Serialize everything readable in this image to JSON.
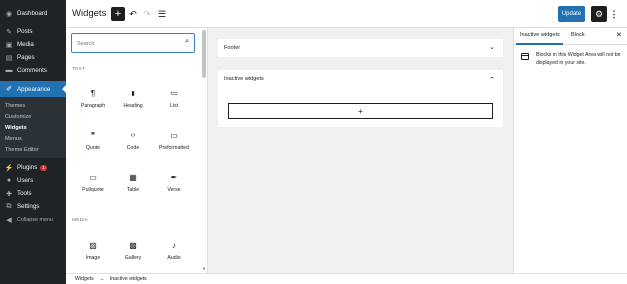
{
  "admin_menu": {
    "items": [
      {
        "label": "Dashboard",
        "icon": "dashboard-icon",
        "glyph": "◉"
      },
      {
        "label": "Posts",
        "icon": "pin-icon",
        "glyph": "✎"
      },
      {
        "label": "Media",
        "icon": "media-icon",
        "glyph": "▣"
      },
      {
        "label": "Pages",
        "icon": "page-icon",
        "glyph": "▤"
      },
      {
        "label": "Comments",
        "icon": "comment-icon",
        "glyph": "▬"
      },
      {
        "label": "Appearance",
        "icon": "brush-icon",
        "glyph": "✐"
      }
    ],
    "submenu": [
      "Themes",
      "Customize",
      "Widgets",
      "Menus",
      "Theme Editor"
    ],
    "items_after": [
      {
        "label": "Plugins",
        "icon": "plug-icon",
        "glyph": "⚡",
        "badge": "1"
      },
      {
        "label": "Users",
        "icon": "users-icon",
        "glyph": "●"
      },
      {
        "label": "Tools",
        "icon": "wrench-icon",
        "glyph": "✚"
      },
      {
        "label": "Settings",
        "icon": "settings-icon",
        "glyph": "⧉"
      },
      {
        "label": "Collapse menu",
        "icon": "collapse-icon",
        "glyph": "◀"
      }
    ]
  },
  "header": {
    "title": "Widgets",
    "add_glyph": "+",
    "undo_glyph": "↶",
    "redo_glyph": "↷",
    "listview_glyph": "☰",
    "update_label": "Update",
    "settings_glyph": "⚙",
    "options_glyph": "⋮"
  },
  "inserter": {
    "search_placeholder": "Search",
    "search_glyph": "⌕",
    "categories": [
      "TEXT",
      "MEDIA"
    ],
    "text_blocks": [
      {
        "label": "Paragraph",
        "glyph": "¶"
      },
      {
        "label": "Heading",
        "glyph": "🔖"
      },
      {
        "label": "List",
        "glyph": "≔"
      },
      {
        "label": "Quote",
        "glyph": "❞"
      },
      {
        "label": "Code",
        "glyph": "‹›"
      },
      {
        "label": "Preformatted",
        "glyph": "▭"
      },
      {
        "label": "Pullquote",
        "glyph": "▭"
      },
      {
        "label": "Table",
        "glyph": "▦"
      },
      {
        "label": "Verse",
        "glyph": "✒"
      }
    ],
    "media_blocks": [
      {
        "label": "Image",
        "glyph": "▨"
      },
      {
        "label": "Gallery",
        "glyph": "▩"
      },
      {
        "label": "Audio",
        "glyph": "♪"
      }
    ]
  },
  "canvas": {
    "footer_area": {
      "title": "Footer",
      "toggle_glyph": "⌄"
    },
    "inactive_area": {
      "title": "Inactive widgets",
      "toggle_glyph": "⌃",
      "appender_glyph": "+"
    }
  },
  "settings_panel": {
    "tab_inactive": "Inactive widgets",
    "tab_block": "Block",
    "close_glyph": "✕",
    "description": "Blocks in this Widget Area will not be displayed in your site."
  },
  "footer": {
    "breadcrumb": [
      "Widgets",
      "→",
      "Inactive widgets"
    ]
  },
  "colors": {
    "admin_bg": "#1d2327",
    "accent": "#2271b1",
    "canvas_bg": "#f0f0f0"
  }
}
